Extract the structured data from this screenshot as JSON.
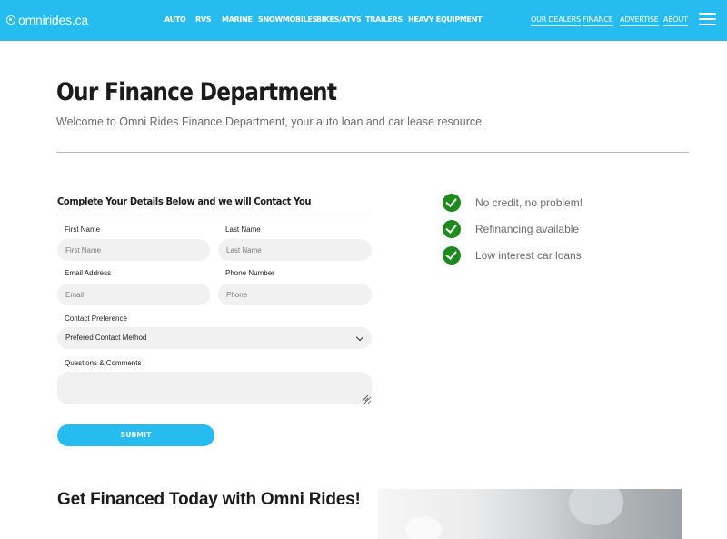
{
  "brand": {
    "logo_text": "omnirides.ca",
    "accent_color": "#27bcef",
    "check_color": "#1e8a1e"
  },
  "nav": {
    "main": [
      "AUTO",
      "RVS",
      "MARINE",
      "SNOWMOBILES",
      "BIKES/ATVS",
      "TRAILERS",
      "HEAVY EQUIPMENT"
    ],
    "secondary": [
      "OUR DEALERS",
      "FINANCE",
      "ADVERTISE",
      "ABOUT"
    ],
    "menu_icon": "hamburger-icon"
  },
  "page": {
    "title": "Our Finance Department",
    "subtitle": "Welcome to Omni Rides Finance Department, your auto loan and car lease resource."
  },
  "form": {
    "title": "Complete Your Details Below and we will Contact You",
    "first_name_label": "First Name",
    "first_name_placeholder": "First Name",
    "last_name_label": "Last Name",
    "last_name_placeholder": "Last Name",
    "email_label": "Email Address",
    "email_placeholder": "Email",
    "phone_label": "Phone Number",
    "phone_placeholder": "Phone",
    "contact_pref_label": "Contact Preference",
    "contact_pref_value": "Prefered Contact Method",
    "comments_label": "Questions & Comments",
    "submit_label": "SUBMIT"
  },
  "benefits": [
    "No credit, no problem!",
    "Refinancing available",
    "Low interest car loans"
  ],
  "bottom": {
    "title": "Get Financed Today with Omni Rides!"
  }
}
